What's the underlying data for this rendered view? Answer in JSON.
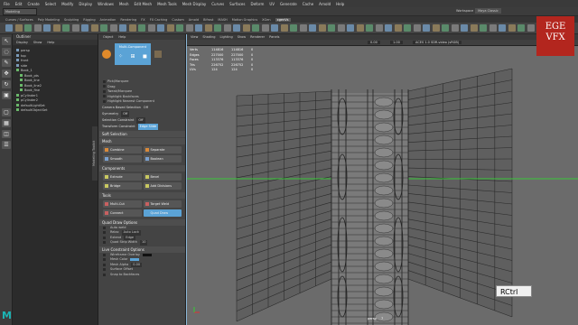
{
  "app": {
    "menubar": [
      "Modeling",
      "File",
      "Edit",
      "Create",
      "Select",
      "Modify",
      "Display",
      "Windows",
      "Mesh",
      "Edit Mesh",
      "Mesh Tools",
      "Mesh Display",
      "Curves",
      "Surfaces",
      "Deform",
      "UV",
      "Generate",
      "Cache",
      "Arnold",
      "Help"
    ],
    "workspace_label": "Workspace",
    "workspace_value": "Maya Classic"
  },
  "shelf_tabs": [
    "Curves / Surfaces",
    "Poly Modeling",
    "Sculpting",
    "Rigging",
    "Animation",
    "Rendering",
    "FX",
    "FX Caching",
    "Custom",
    "Arnold",
    "Bifrost",
    "MASH",
    "Motion Graphics",
    "XGen",
    "xgenVs"
  ],
  "shelf_active": "xgenVs",
  "outliner": {
    "title": "Outliner",
    "menu": [
      "Display",
      "Show",
      "Help"
    ],
    "items": [
      "persp",
      "top",
      "front",
      "side",
      "Book_1",
      "Book_pts",
      "Book_line",
      "Book_line2",
      "Book_fine",
      "pCylinder1",
      "pCylinder2",
      "defaultLightSet",
      "defaultObjectSet"
    ]
  },
  "object_panel": {
    "menu": [
      "Object",
      "Help"
    ],
    "tool_label": "Multi-Component",
    "options": [
      "Pick/Marquee",
      "Drag",
      "Tweak/Marquee",
      "Highlight Backfaces",
      "Highlight Nearest Component"
    ],
    "falloff_label": "Camera Based Selection",
    "falloff_value": "Off",
    "symmetry_label": "Symmetry",
    "symmetry_value": "Off",
    "sel_constraint_label": "Selection Constraint",
    "sel_constraint_value": "Off",
    "transform_constraint_label": "Transform Constraint",
    "transform_constraint_value": "Edge Slide",
    "soft_label": "Soft Selection",
    "sections": {
      "mesh": "Mesh",
      "components": "Components",
      "tools": "Tools",
      "quad_draw": "Quad Draw Options",
      "live_constraint": "Live Constraint Options"
    },
    "mesh_buttons": [
      "Combine",
      "Separate",
      "Smooth",
      "Boolean"
    ],
    "component_buttons": [
      "Extrude",
      "Bevel",
      "Bridge",
      "Add Divisions"
    ],
    "tool_buttons": [
      "Multi-Cut",
      "Target Weld",
      "Connect",
      "Quad Draw"
    ],
    "quad_rows": [
      "Auto weld",
      "Relax",
      "Extend",
      "Quad Strip Width"
    ],
    "quad_values": [
      "",
      "Auto Lock",
      "Edge",
      "10"
    ],
    "live_rows": [
      "Wireframe Overlay",
      "Mesh Color",
      "Mesh Alpha",
      "Surface Offset",
      "Snap to Backfaces"
    ],
    "live_values": [
      "",
      "",
      "0.00",
      "",
      ""
    ],
    "sidetab": "Modeling Toolkit"
  },
  "viewport": {
    "menu": [
      "View",
      "Shading",
      "Lighting",
      "Show",
      "Renderer",
      "Panels"
    ],
    "hud": {
      "rows": [
        {
          "label": "Verts",
          "a": "114816",
          "b": "114816",
          "c": "0"
        },
        {
          "label": "Edges",
          "a": "227000",
          "b": "227000",
          "c": "0"
        },
        {
          "label": "Faces",
          "a": "113376",
          "b": "113376",
          "c": "0"
        },
        {
          "label": "Tris",
          "a": "226752",
          "b": "226752",
          "c": "0"
        },
        {
          "label": "UVs",
          "a": "124",
          "b": "124",
          "c": "0"
        }
      ]
    },
    "color_space": "ACES 1.0 SDR-video (sRGB)",
    "frame_value": "0.00",
    "scale_value": "1.00",
    "camera_label": "persp",
    "vertex_label": "7"
  },
  "overlay": {
    "key_hint": "RCtrl"
  },
  "logo": {
    "line1": "EGE",
    "line2": "VFX"
  },
  "colors": {
    "accent": "#5ba3d6",
    "selection": "#4cd04c",
    "logo_bg": "#b3261e",
    "maya": "#1bb5b5"
  },
  "icons": {
    "maya_logo": "M"
  }
}
